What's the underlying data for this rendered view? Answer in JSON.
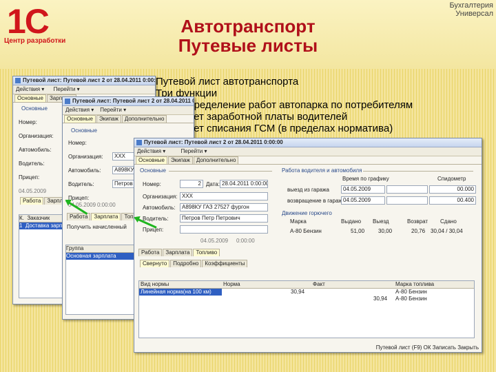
{
  "logo": {
    "mark": "1С",
    "caption": "Центр разработки"
  },
  "corner": {
    "line1": "Бухгалтерия",
    "line2": "Универсал"
  },
  "title": {
    "line1": "Автотранспорт",
    "line2": "Путевые листы"
  },
  "info": {
    "heading": "Путевой лист автотранспорта",
    "subheading": "Три функции",
    "bullets": [
      "распределение работ автопарка по потребителям",
      "расчет заработной платы водителей",
      "расчет списания ГСМ (в пределах норматива)"
    ]
  },
  "win1": {
    "title": "Путевой лист: Путевой лист 2 от 28.04.2011 0:00:00",
    "toolbar_actions": "Действия ▾",
    "toolbar_goto": "Перейти ▾",
    "tab1": "Основные",
    "tab2": "Зарплата",
    "group": "Основные",
    "labels": [
      "Номер:",
      "Организация:",
      "Автомобиль:",
      "Водитель:",
      "Прицеп:"
    ],
    "date": "04.05.2009",
    "subtabs": [
      "Работа",
      "Зарплата"
    ],
    "col_k": "К.",
    "col_customer": "Заказчик",
    "row_num": "1",
    "row_text": "Доставка зарпл"
  },
  "win2": {
    "title": "Путевой лист: Путевой лист 2 от 28.04.2011 0:00:00",
    "toolbar_actions": "Действия ▾",
    "toolbar_goto": "Перейти ▾",
    "tab1": "Основные",
    "tab2": "Экипаж",
    "tab3": "Дополнительно",
    "group": "Основные",
    "labels": [
      "Номер:",
      "Организация:",
      "Автомобиль:",
      "Водитель:",
      "Прицеп:"
    ],
    "org": "ХХХ",
    "car": "А898КУ ГАЗ",
    "driver": "Петров Пет",
    "date": "04.05.2009",
    "time": "0:00:00",
    "subtabs": [
      "Работа",
      "Зарплата",
      "Топливо"
    ],
    "sub_toolbar": "Получить начисленный",
    "col_group": "Группа",
    "row_group": "Основная зарплата"
  },
  "win3": {
    "title": "Путевой лист: Путевой лист 2 от 28.04.2011 0:00:00",
    "toolbar_actions": "Действия ▾",
    "toolbar_goto": "Перейти ▾",
    "tab1": "Основные",
    "tab2": "Экипаж",
    "tab3": "Дополнительно",
    "group_main": "Основные",
    "number_label": "Номер:",
    "number": "2",
    "date_label": "Дата:",
    "date": "28.04.2011 0:00:00",
    "org_label": "Организация:",
    "org": "ХХХ",
    "car_label": "Автомобиль:",
    "car": "А898КУ ГАЗ 27527 фургон",
    "driver_label": "Водитель:",
    "driver": "Петров Петр Петрович",
    "trailer_label": "Прицеп:",
    "date2": "04.05.2009",
    "time2": "0:00:00",
    "group_work": "Работа водителя и автомобиля",
    "col_time": "Время по графику",
    "col_speedo": "Спидометр",
    "depart_label": "выезд из гаража",
    "return_label": "возвращение в гараж",
    "depart_date": "04.05.2009",
    "return_date": "04.05.2009",
    "speedo1": "00.000",
    "speedo2": "00.400",
    "group_fuel": "Движение горючего",
    "fuel_cols": [
      "Марка",
      "Выдано",
      "Выезд",
      "Возврат",
      "Сдано"
    ],
    "fuel_mark": "А-80 Бензин",
    "fuel_vals": [
      "51,00",
      "30,00",
      "20,76"
    ],
    "fuel_side": "30,04 / 30,04",
    "subtabs": [
      "Работа",
      "Зарплата",
      "Топливо"
    ],
    "btns": [
      "Свернуто",
      "Подробно",
      "Коэффициенты"
    ],
    "grid_cols": [
      "Вид нормы",
      "Норма",
      "Факт",
      "Марка топлива"
    ],
    "row1": [
      "Линейная норма(на 100 км)",
      "30,94",
      "",
      "А-80 Бензин"
    ],
    "row2": [
      "",
      "",
      "30,94",
      "А-80 Бензин"
    ],
    "footer": "Путевой лист (F9)   ОК   Записать   Закрыть"
  }
}
